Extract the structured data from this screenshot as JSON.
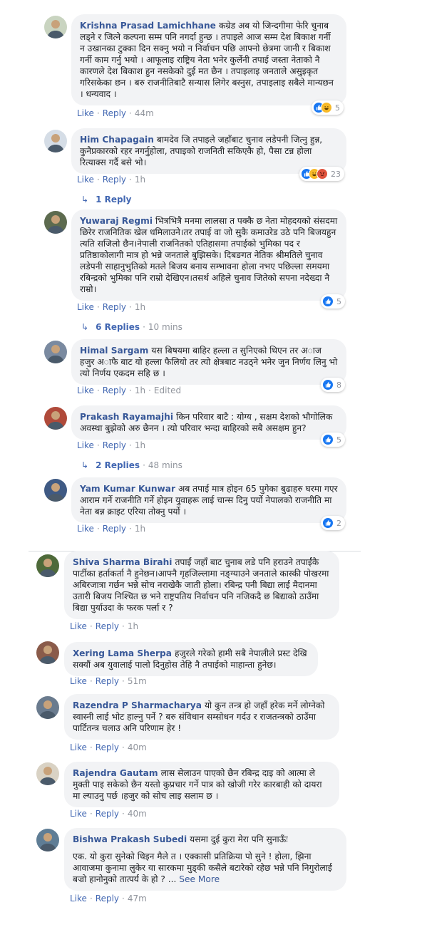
{
  "ui": {
    "like": "Like",
    "reply": "Reply",
    "dot": "·",
    "edited": "Edited",
    "see_more": "See More"
  },
  "comments": [
    {
      "name": "Krishna Prasad Lamichhane",
      "text": "कम्रेड अब यो जिन्दगीमा फेरि चुनाब लड्ने र जित्ने कल्पना सम्म पनि नगर्दा हुन्छ । तपाइले आज सम्म देश बिकाश गर्नी न उखानका टुक्का दिन सक्नु भयो न निर्वाचन पछि आफ्नो छेत्रमा जानी र बिकाश गर्नी काम गर्नु भयो । आफूलाइ राष्ट्रिय नेता भनेर कुर्लेनी तपाई जस्ता नेताको नै कारणले देश बिकाश हुन नसकेको दुई मत छैन । तपाइलाइ जनताले असुइकृत गरिसकेका छन । बरु राजनीतिबाटै सन्यास लिगेर बस्नुस, तपाइलाइ सबैले मान्यछन । धन्यवाद ।",
      "time": "44m",
      "reactions": [
        "like",
        "haha"
      ],
      "count": "5"
    },
    {
      "name": "Him Chapagain",
      "text": "बामदेव जि तपाइले जहाँबाट चुनाव लडेपनी जित्नु हुन्न, कुनैप्रकारको रहर नगर्नुहोला, तपाइको राजनिती सकिएकै हो, पैसा टन्न होला रित्याक्स गर्दै बसे भो।",
      "time": "1h",
      "reactions": [
        "like",
        "haha",
        "angry"
      ],
      "count": "23",
      "replies_label": "1 Reply",
      "replies_time": ""
    },
    {
      "name": "Yuwaraj Regmi",
      "text": "भित्रभित्रै मनमा लालसा त पक्कै छ नेता मोहदयको संसदमा छिरेर राजनितिक खेल धमिलाउने।तर तपाई वा जो सुकै कमाउरेड उठे पनि बिजयहुन त्यति सजिलो छैन।नेपाली राजनितको एतिहासमा तपाईको भुमिका पद र प्रतिष्ठाकोलागी मात्र हो भन्ने जनताले बुझिसके। दिबङगत नेतिक श्रीमतिले चुनाव लडेपनी साहानुभुतिको मतले बिजय बनाय सम्भावना होला नभए पछिल्ला समयमा रबिन्द्रको भुमिका पनि राम्रो देखिएन।तसर्थ अहिले चुनाव जितेको सपना नदेख्दा नै राम्रो।",
      "time": "1h",
      "reactions": [
        "like"
      ],
      "count": "5",
      "replies_label": "6 Replies",
      "replies_time": "10 mins"
    },
    {
      "name": "Himal Sargam",
      "text": "यस बिषयमा बाहिर हल्ला त सुनिएको थिएन तर अाज हजुर अाफै बाट यो हल्ला फैलियो तर त्यो क्षेत्रबाट नउठ्ने भनेर जुन निर्णय लिनु भो त्यो निर्णय एकदम सहि छ ।",
      "time": "1h",
      "edited": true,
      "reactions": [
        "like"
      ],
      "count": "8"
    },
    {
      "name": "Prakash Rayamajhi",
      "text": "किन परिवार बाटै : योग्य , सक्षम देशको भौगोलिक अवस्था बुझेको अरु छैनन । त्यो परिवार भन्दा बाहिरको सबै असक्षम हुन?",
      "time": "1h",
      "reactions": [
        "like"
      ],
      "count": "5",
      "replies_label": "2 Replies",
      "replies_time": "48 mins"
    },
    {
      "name": "Yam Kumar Kunwar",
      "text": "अब तपाई मात्र होइन 65 पुगेका बुढाहरु घरमा गएर आराम गर्ने राजनीति गर्ने होइन युवाहरू लाई चान्स दिनु पर्यो नेपालको राजनीति मा नेता बन्न क्राइट एरिया तोक्नु पर्यो ।",
      "time": "1h",
      "reactions": [
        "like"
      ],
      "count": "2"
    },
    {
      "name": "Shiva Sharma Birahi",
      "text": "तपाईं जहाँ बाट चुनाब लडे पनि हराउने तपाईंकै पार्टीका हर्ताकर्ता नै हुनेछन।आफ्नै गृहजिल्लामा नङ्ग्याउने जनताले कास्की पोखरमा अबिरजात्रा गर्छन भन्ने सोच नराखेकै जाती होला। रबिन्द्र पनी बिद्या लाई मैदानमा उतारी बिजय निश्चित छ भने राष्ट्रपतिय निर्वाचन पनि नजिकदै छ बिद्याको ठाउँमा बिद्या पुर्याउदा के फरक पर्ला र ?",
      "time": "1h"
    },
    {
      "name": "Xering Lama Sherpa",
      "text": "हजुरले गरेको हामी सबै नेपालीले प्रस्ट देखि सक्यौं अब युवालाई पालो दिनुहोस तेहि नै तपाईको माहान्ता हुनेछ।",
      "time": "51m"
    },
    {
      "name": "Razendra P Sharmacharya",
      "text": "यो कुन तन्त्र हो जहाँ हरेक मर्ने लोग्नेको स्वास्नी लाई भोट हाल्नु पर्ने ? बरु संविधान सम्सोधन गर्दउ र राजतन्त्रको ठाउँमा पार्टितन्त्र चलाउ अनि परिणाम हेर !",
      "time": "40m"
    },
    {
      "name": "Rajendra Gautam",
      "text": "लास सेलाउन पाएको छैन रबिन्द्र दाइ को आत्मा ले मुक्ती पाइ सकेको छैन यस्तो कुप्रचार गर्ने पात्र को खोजी गरेर कारबाही को दायरा मा ल्याउनु पर्छ ।हजुर को सोच लाइ सलाम छ ।",
      "time": "40m"
    },
    {
      "name": "Bishwa Prakash Subedi",
      "text": "यसमा दुई कुरा मेरा पनि सुनाऊँः",
      "text2": "एक. यो कुरा सुनेको थिइन मैले त । एक्कासी प्रतिक्रिया पो सुने ! होला, झिना आवाजमा कुनामा लुकेर या सारकमा मुड्की कसैले बटारेको रहेछ भन्ने पनि निगुरोलाई बज्रो हानोनुको तात्पर्य के हो ? ...",
      "time": "47m"
    }
  ],
  "colors": {
    "name": "#385898",
    "link": "#4267b2",
    "bubble": "#f2f3f5",
    "muted": "#90949c",
    "like": "#1877f2",
    "haha": "#f7b928",
    "angry": "#e0533d"
  },
  "icons": {
    "like": "thumbs-up-icon",
    "haha": "laughing-face-icon",
    "angry": "angry-face-icon",
    "reply_arrow": "reply-arrow-icon"
  }
}
